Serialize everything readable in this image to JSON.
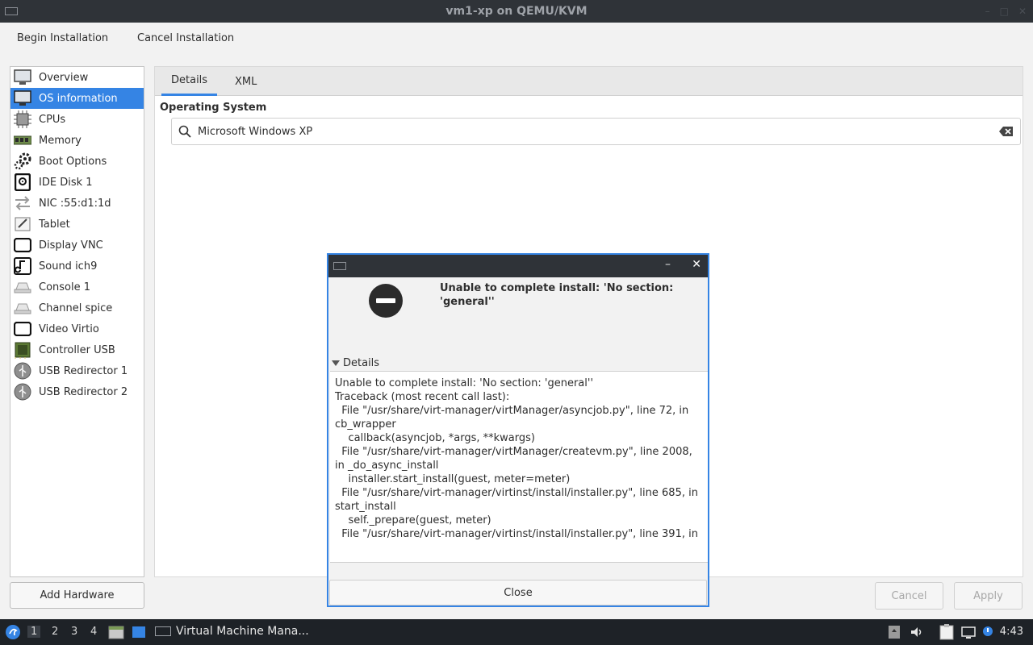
{
  "window": {
    "title": "vm1-xp on QEMU/KVM"
  },
  "menu": {
    "begin": "Begin Installation",
    "cancel": "Cancel Installation"
  },
  "sidebar": {
    "items": [
      {
        "label": "Overview",
        "icon": "monitor-icon"
      },
      {
        "label": "OS information",
        "icon": "monitor-icon",
        "selected": true
      },
      {
        "label": "CPUs",
        "icon": "cpu-icon"
      },
      {
        "label": "Memory",
        "icon": "memory-icon"
      },
      {
        "label": "Boot Options",
        "icon": "gears-icon"
      },
      {
        "label": "IDE Disk 1",
        "icon": "disk-icon"
      },
      {
        "label": "NIC :55:d1:1d",
        "icon": "network-icon"
      },
      {
        "label": "Tablet",
        "icon": "tablet-icon"
      },
      {
        "label": "Display VNC",
        "icon": "display-icon"
      },
      {
        "label": "Sound ich9",
        "icon": "sound-icon"
      },
      {
        "label": "Console 1",
        "icon": "console-icon"
      },
      {
        "label": "Channel spice",
        "icon": "channel-icon"
      },
      {
        "label": "Video Virtio",
        "icon": "video-icon"
      },
      {
        "label": "Controller USB",
        "icon": "controller-icon"
      },
      {
        "label": "USB Redirector 1",
        "icon": "usb-icon"
      },
      {
        "label": "USB Redirector 2",
        "icon": "usb-icon"
      }
    ],
    "add_hardware": "Add Hardware"
  },
  "tabs": {
    "details": "Details",
    "xml": "XML"
  },
  "os": {
    "section_label": "Operating System",
    "search_value": "Microsoft Windows XP"
  },
  "buttons": {
    "cancel": "Cancel",
    "apply": "Apply"
  },
  "dialog": {
    "heading": "Unable to complete install: 'No section: 'general''",
    "details_label": "Details",
    "trace_lines": [
      "Unable to complete install: 'No section: 'general''",
      "",
      "Traceback (most recent call last):",
      "  File \"/usr/share/virt-manager/virtManager/asyncjob.py\", line 72, in",
      "cb_wrapper",
      "    callback(asyncjob, *args, **kwargs)",
      "  File \"/usr/share/virt-manager/virtManager/createvm.py\", line 2008,",
      "in _do_async_install",
      "    installer.start_install(guest, meter=meter)",
      "  File \"/usr/share/virt-manager/virtinst/install/installer.py\", line 685, in",
      "start_install",
      "    self._prepare(guest, meter)",
      "  File \"/usr/share/virt-manager/virtinst/install/installer.py\", line 391, in"
    ],
    "close_label": "Close"
  },
  "taskbar": {
    "workspaces": [
      "1",
      "2",
      "3",
      "4"
    ],
    "app_label": "Virtual Machine Mana...",
    "clock": "4:43"
  },
  "colors": {
    "accent": "#3584e4",
    "titlebar": "#2f3338",
    "taskbar": "#1e2227"
  }
}
